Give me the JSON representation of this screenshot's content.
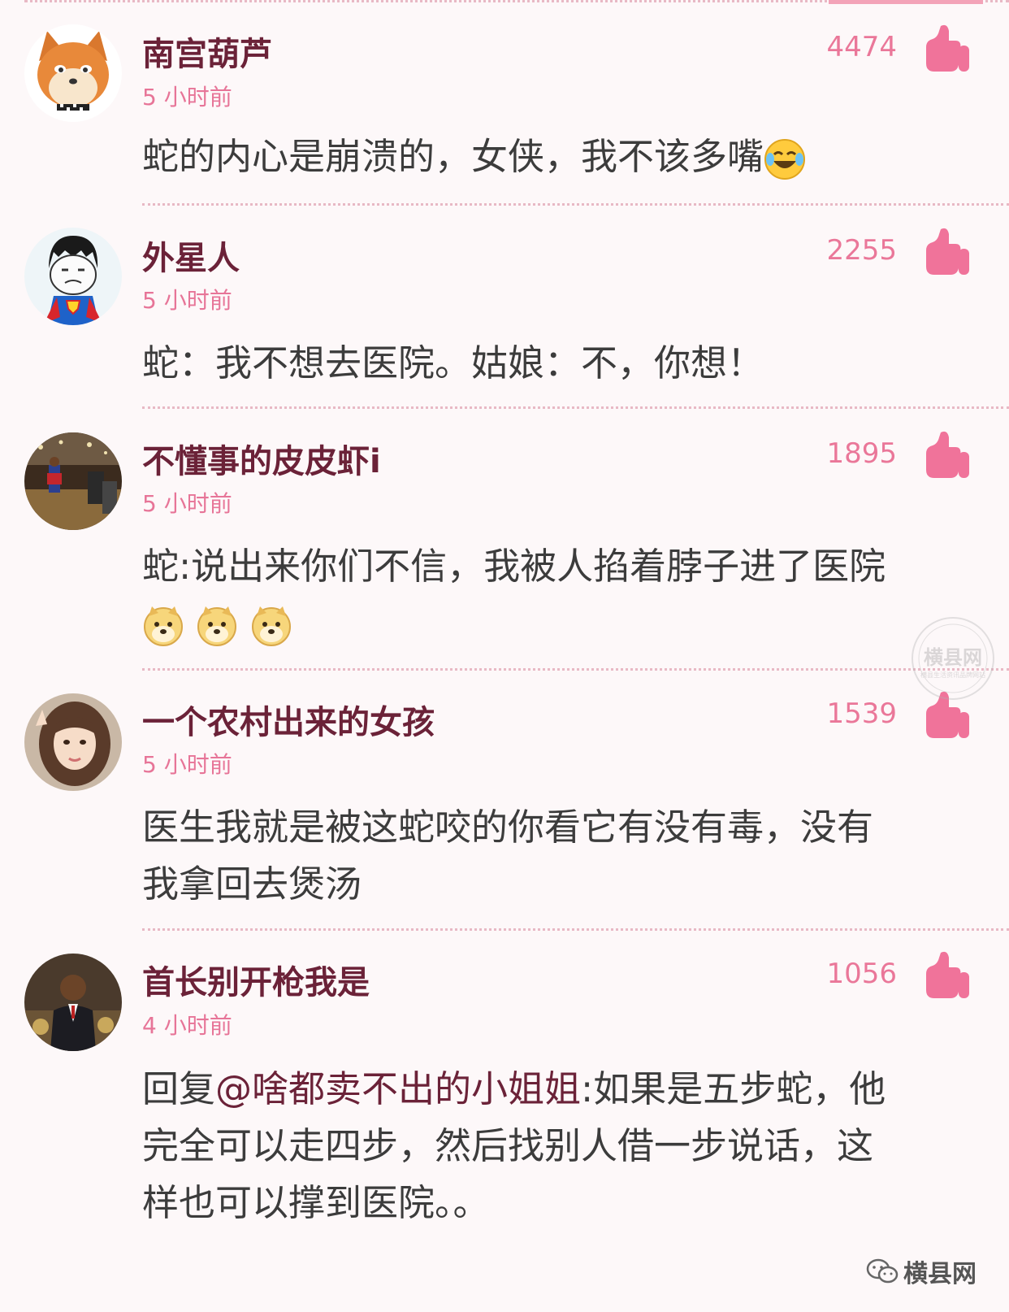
{
  "colors": {
    "background": "#fdf8f9",
    "username": "#6b2238",
    "time": "#e77598",
    "likes": "#ea7799",
    "thumb": "#f0739a",
    "divider": "#e8b9c5",
    "text": "#3c3c3c"
  },
  "comments": [
    {
      "username": "南宫葫芦",
      "time": "5 小时前",
      "likes": "4474",
      "avatar_icon": "shiba-cartoon-avatar",
      "lines": [
        "蛇的内心是崩溃的，女侠，我不该多嘴"
      ],
      "emoji": "laughing-crying-emoji"
    },
    {
      "username": "外星人",
      "time": "5 小时前",
      "likes": "2255",
      "avatar_icon": "superman-meme-avatar",
      "lines": [
        "蛇：我不想去医院。姑娘：不，你想！"
      ]
    },
    {
      "username": "不懂事的皮皮虾i",
      "time": "5 小时前",
      "likes": "1895",
      "avatar_icon": "basketball-photo-avatar",
      "lines": [
        "蛇:说出来你们不信，我被人掐着脖子进了医院"
      ],
      "emoji": "doge-emoji"
    },
    {
      "username": "一个农村出来的女孩",
      "time": "5 小时前",
      "likes": "1539",
      "avatar_icon": "girl-photo-avatar",
      "lines": [
        "医生我就是被这蛇咬的你看它有没有毒，没有",
        "我拿回去煲汤"
      ]
    },
    {
      "username": "首长别开枪我是",
      "time": "4 小时前",
      "likes": "1056",
      "avatar_icon": "man-suit-photo-avatar",
      "reply_prefix": "回复",
      "reply_mention": "@啥都卖不出的小姐姐",
      "lines": [
        ":如果是五步蛇，他",
        "完全可以走四步，然后找别人借一步说话，这",
        "样也可以撑到医院。。"
      ]
    }
  ],
  "watermark": {
    "seal_text": "横县网",
    "seal_subtext": "横县生活资讯品牌网站",
    "footer_brand": "横县网",
    "footer_icon": "wechat-icon"
  }
}
